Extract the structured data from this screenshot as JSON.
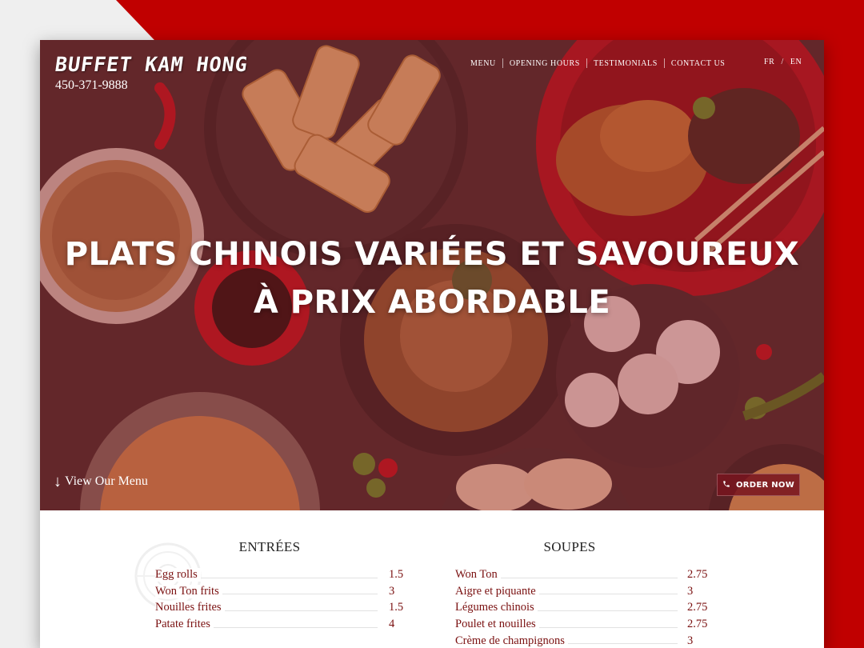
{
  "header": {
    "brand": "BUFFET KAM HONG",
    "phone": "450-371-9888",
    "nav": [
      "MENU",
      "OPENING HOURS",
      "TESTIMONIALS",
      "CONTACT US"
    ],
    "languages": [
      "FR",
      "EN"
    ],
    "lang_separator": "/"
  },
  "hero": {
    "headline_line1": "PLATS CHINOIS VARIÉES ET SAVOUREUX",
    "headline_line2": "À PRIX ABORDABLE",
    "view_menu_label": "View Our Menu",
    "view_menu_arrow": "↓",
    "order_button_label": "ORDER NOW",
    "phone_icon": "phone-icon"
  },
  "menu": {
    "entrees": {
      "title": "ENTRÉES",
      "items": [
        {
          "name": "Egg rolls",
          "price": "1.5"
        },
        {
          "name": "Won Ton frits",
          "price": "3"
        },
        {
          "name": "Nouilles frites",
          "price": "1.5"
        },
        {
          "name": "Patate frites",
          "price": "4"
        }
      ]
    },
    "soupes": {
      "title": "SOUPES",
      "items": [
        {
          "name": "Won Ton",
          "price": "2.75"
        },
        {
          "name": "Aigre et piquante",
          "price": "3"
        },
        {
          "name": "Légumes chinois",
          "price": "2.75"
        },
        {
          "name": "Poulet et nouilles",
          "price": "2.75"
        },
        {
          "name": "Crème de champignons",
          "price": "3"
        }
      ]
    }
  },
  "colors": {
    "accent_red": "#c00000",
    "menu_text": "#7a1010"
  }
}
